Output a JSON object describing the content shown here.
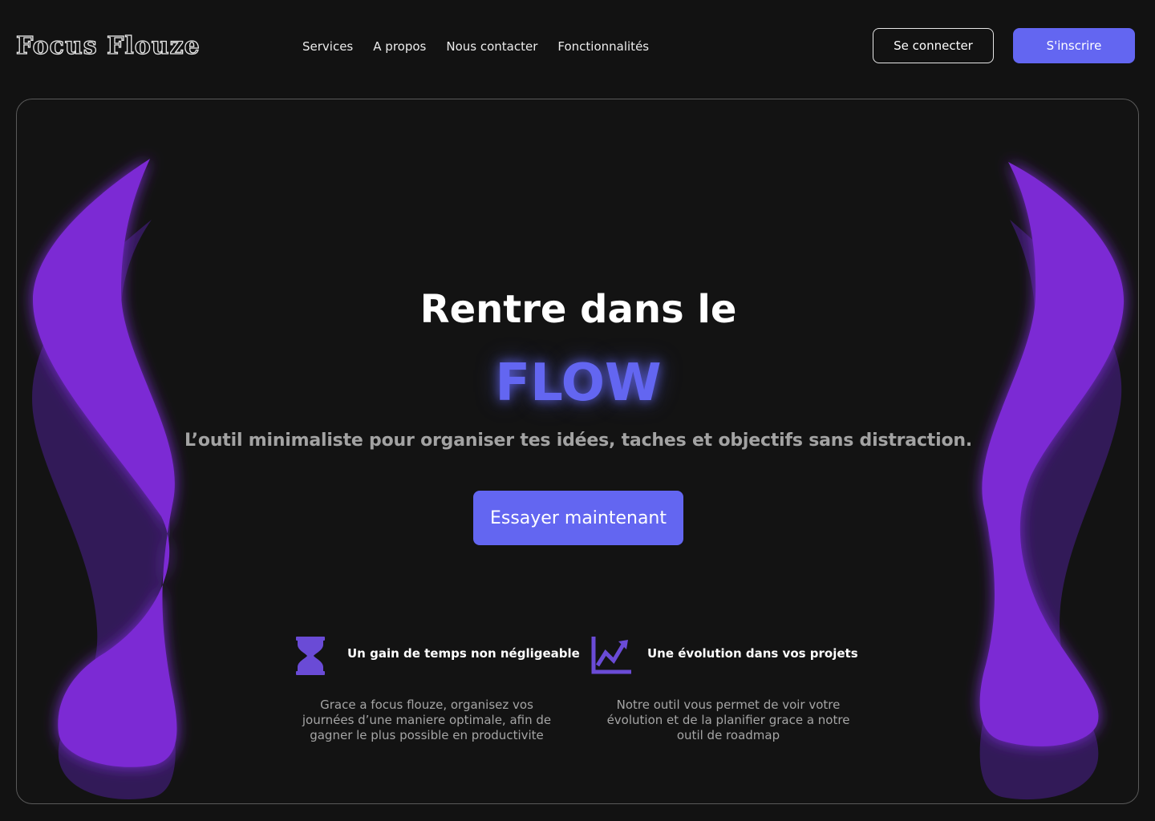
{
  "header": {
    "logo": "Focus Flouze",
    "nav": [
      "Services",
      "A propos",
      "Nous contacter",
      "Fonctionnalités"
    ],
    "login_label": "Se connecter",
    "signup_label": "S'inscrire"
  },
  "hero": {
    "title": "Rentre dans le",
    "highlight": "FLOW",
    "subtitle": "L’outil minimaliste pour organiser tes idées, taches et objectifs sans distraction.",
    "cta_label": "Essayer maintenant"
  },
  "features": [
    {
      "icon": "hourglass-icon",
      "title": "Un gain de temps non négligeable",
      "text": "Grace a focus flouze, organisez vos journées d’une maniere optimale, afin de gagner le plus possible en productivite"
    },
    {
      "icon": "line-chart-icon",
      "title": "Une évolution dans vos projets",
      "text": "Notre outil vous permet de voir votre évolution et de la planifier grace a notre outil de roadmap"
    }
  ],
  "colors": {
    "background": "#121212",
    "accent": "#6366f1",
    "blob": "#7b2bd4",
    "muted_text": "#a3a3a3"
  }
}
